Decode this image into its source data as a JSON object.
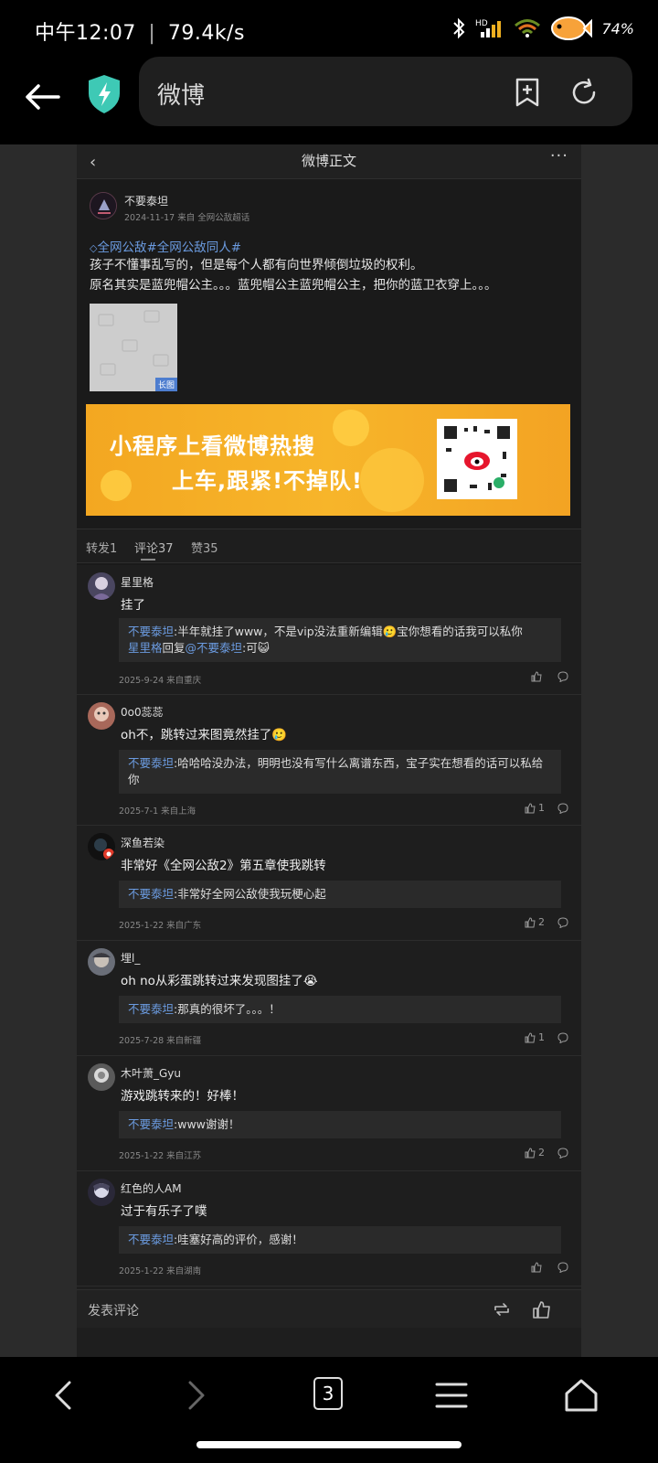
{
  "status_bar": {
    "time": "中午12:07",
    "net_speed": "79.4k/s",
    "battery": "74%"
  },
  "browser": {
    "url_text": "微博",
    "tab_count": "3"
  },
  "weibo": {
    "header_title": "微博正文",
    "post": {
      "author": "不要泰坦",
      "meta": "2024-11-17 来自 全网公敌超话",
      "tags": "全网公敌#全网公敌同人#",
      "line1": "孩子不懂事乱写的，但是每个人都有向世界倾倒垃圾的权利。",
      "line2": "原名其实是蓝兜帽公主。。。蓝兜帽公主蓝兜帽公主，把你的蓝卫衣穿上。。。",
      "thumb_tag": "长图",
      "banner_line1": "小程序上看微博热搜",
      "banner_line2": "上车,跟紧!不掉队!"
    },
    "tabs": {
      "repost": "转发1",
      "comments": "评论37",
      "likes": "赞35"
    },
    "comments": [
      {
        "name": "星里格",
        "text": "挂了",
        "reply_who": "不要泰坦",
        "reply_text": ":半年就挂了www，不是vip没法重新编辑🥲宝你想看的话我可以私你",
        "reply2_who": "星里格",
        "reply2_mid": "回复",
        "reply2_at": "@不要泰坦",
        "reply2_text": ":可😺",
        "date": "2025-9-24 来自重庆",
        "likes": ""
      },
      {
        "name": "0o0蕊蕊",
        "text": "oh不，跳转过来图竟然挂了🥲",
        "reply_who": "不要泰坦",
        "reply_text": ":哈哈哈没办法，明明也没有写什么离谱东西，宝子实在想看的话可以私给你",
        "date": "2025-7-1 来自上海",
        "likes": "1"
      },
      {
        "name": "深鱼若染",
        "text": "非常好《全网公敌2》第五章使我跳转",
        "reply_who": "不要泰坦",
        "reply_text": ":非常好全网公敌使我玩梗心起",
        "date": "2025-1-22 来自广东",
        "likes": "2"
      },
      {
        "name": "埋l_",
        "text": "oh no从彩蛋跳转过来发现图挂了😭",
        "reply_who": "不要泰坦",
        "reply_text": ":那真的很坏了。。。！",
        "date": "2025-7-28 来自新疆",
        "likes": "1"
      },
      {
        "name": "木叶萧_Gyu",
        "text": "游戏跳转来的！好棒！",
        "reply_who": "不要泰坦",
        "reply_text": ":www谢谢！",
        "date": "2025-1-22 来自江苏",
        "likes": "2"
      },
      {
        "name": "红色的人AM",
        "text": "过于有乐子了噗",
        "reply_who": "不要泰坦",
        "reply_text": ":哇塞好高的评价，感谢！",
        "date": "2025-1-22 来自湖南",
        "likes": ""
      }
    ],
    "footer": {
      "post_comment": "发表评论"
    }
  },
  "colors": {
    "link": "#6b9be0",
    "shield": "#3ec9b5",
    "banner": "#f5ad24"
  }
}
